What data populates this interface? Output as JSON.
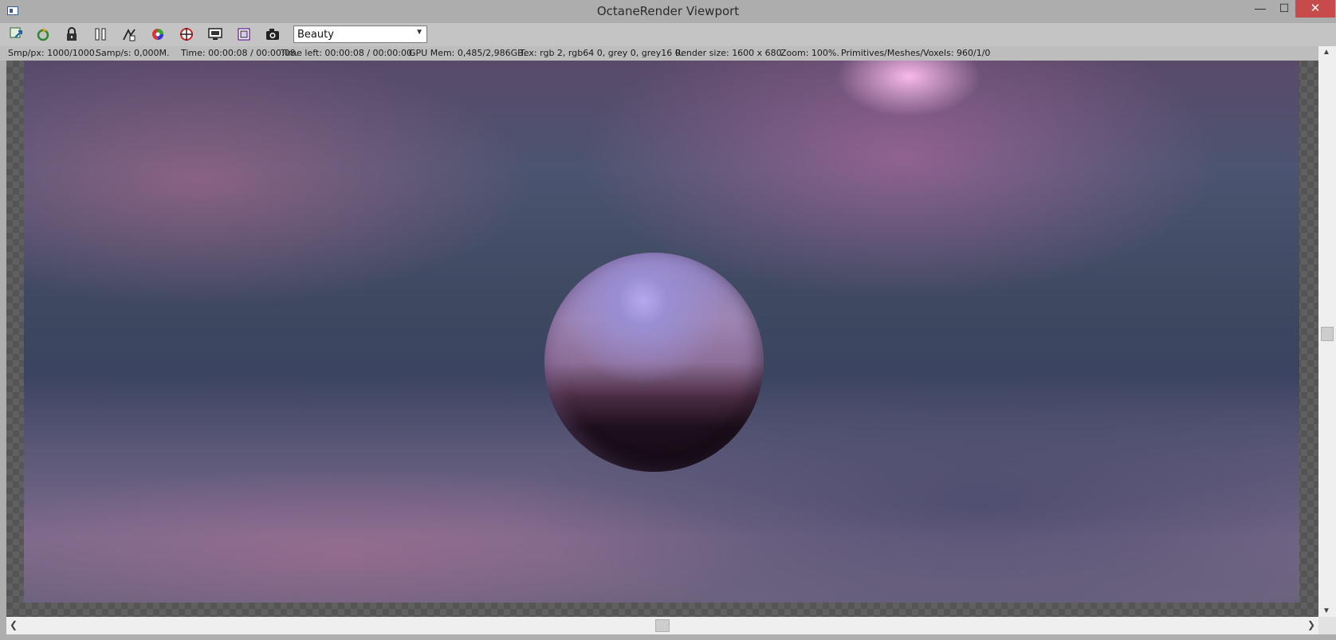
{
  "window": {
    "title": "OctaneRender Viewport",
    "minimize": "—",
    "maximize": "☐",
    "close": "✕"
  },
  "toolbar": {
    "icons": [
      "send-scene-icon",
      "restart-render-icon",
      "lock-icon",
      "pause-icon",
      "focus-picker-icon",
      "white-balance-icon",
      "material-picker-icon",
      "render-region-icon",
      "film-region-icon",
      "camera-icon"
    ],
    "pass_selected": "Beauty"
  },
  "status": {
    "smp_px": "Smp/px: 1000/1000.",
    "samp_s": "Samp/s: 0,000M.",
    "time": "Time: 00:00:08 / 00:00:08.",
    "time_left": "Time left: 00:00:08 / 00:00:00.",
    "gpu_mem": "GPU Mem: 0,485/2,986GB.",
    "tex": "Tex: rgb 2, rgb64 0, grey 0, grey16 0.",
    "render_size": "Render size: 1600 x 680.",
    "zoom": "Zoom: 100%.",
    "primitives": "Primitives/Meshes/Voxels: 960/1/0"
  },
  "scroll": {
    "up": "▲",
    "down": "▼",
    "left": "❮",
    "right": "❯"
  },
  "colors": {
    "close_button": "#c74b4a",
    "titlebar": "#adadad",
    "toolbar": "#c4c4c4"
  }
}
